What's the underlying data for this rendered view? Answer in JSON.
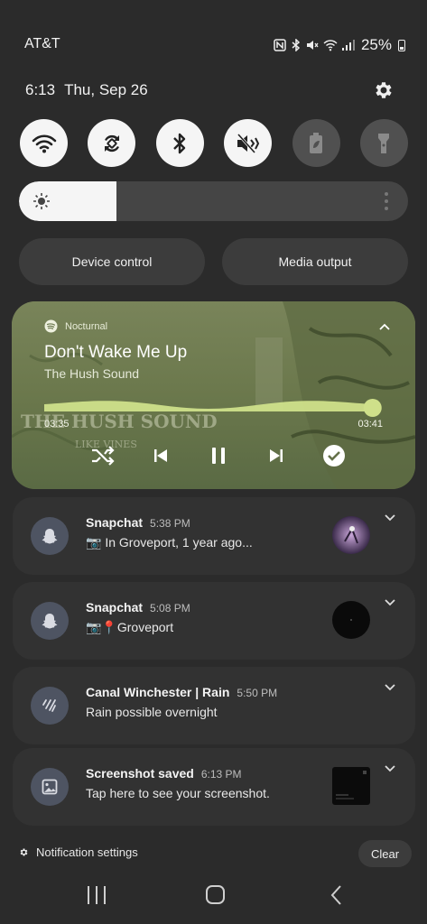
{
  "status_bar": {
    "carrier": "AT&T",
    "battery_percent": "25%",
    "icons": [
      "nfc-icon",
      "bluetooth-icon",
      "mute-icon",
      "wifi-calling-icon",
      "signal-icon",
      "battery-icon"
    ]
  },
  "header": {
    "time": "6:13",
    "date": "Thu, Sep 26"
  },
  "quick_settings": {
    "toggles": [
      {
        "name": "wifi",
        "icon": "wifi-icon",
        "state": "on"
      },
      {
        "name": "auto-rotate",
        "icon": "rotate-icon",
        "state": "on"
      },
      {
        "name": "bluetooth",
        "icon": "bluetooth-icon",
        "state": "on"
      },
      {
        "name": "sound",
        "icon": "mute-icon",
        "state": "on"
      },
      {
        "name": "power-saving",
        "icon": "battery-leaf-icon",
        "state": "off"
      },
      {
        "name": "flashlight",
        "icon": "flashlight-icon",
        "state": "off"
      }
    ],
    "brightness_level": 0.25,
    "device_control_label": "Device control",
    "media_output_label": "Media output"
  },
  "media": {
    "source": "Nocturnal",
    "title": "Don't Wake Me Up",
    "artist": "The Hush Sound",
    "elapsed": "03:35",
    "duration": "03:41",
    "progress": 0.97,
    "accent_color": "#cfe08a"
  },
  "notifications": [
    {
      "app": "Snapchat",
      "time": "5:38 PM",
      "body": "📷 In Groveport, 1 year ago...",
      "icon": "snapchat-ghost-icon"
    },
    {
      "app": "Snapchat",
      "time": "5:08 PM",
      "body": "📷📍Groveport",
      "icon": "snapchat-ghost-icon"
    },
    {
      "app": "Canal Winchester | Rain",
      "time": "5:50 PM",
      "body": "Rain possible overnight",
      "icon": "rain-icon"
    },
    {
      "app": "Screenshot saved",
      "time": "6:13 PM",
      "body": "Tap here to see your screenshot.",
      "icon": "image-icon"
    }
  ],
  "footer": {
    "notification_settings_label": "Notification settings",
    "clear_label": "Clear"
  },
  "navigation": [
    "recents-icon",
    "home-icon",
    "back-icon"
  ]
}
